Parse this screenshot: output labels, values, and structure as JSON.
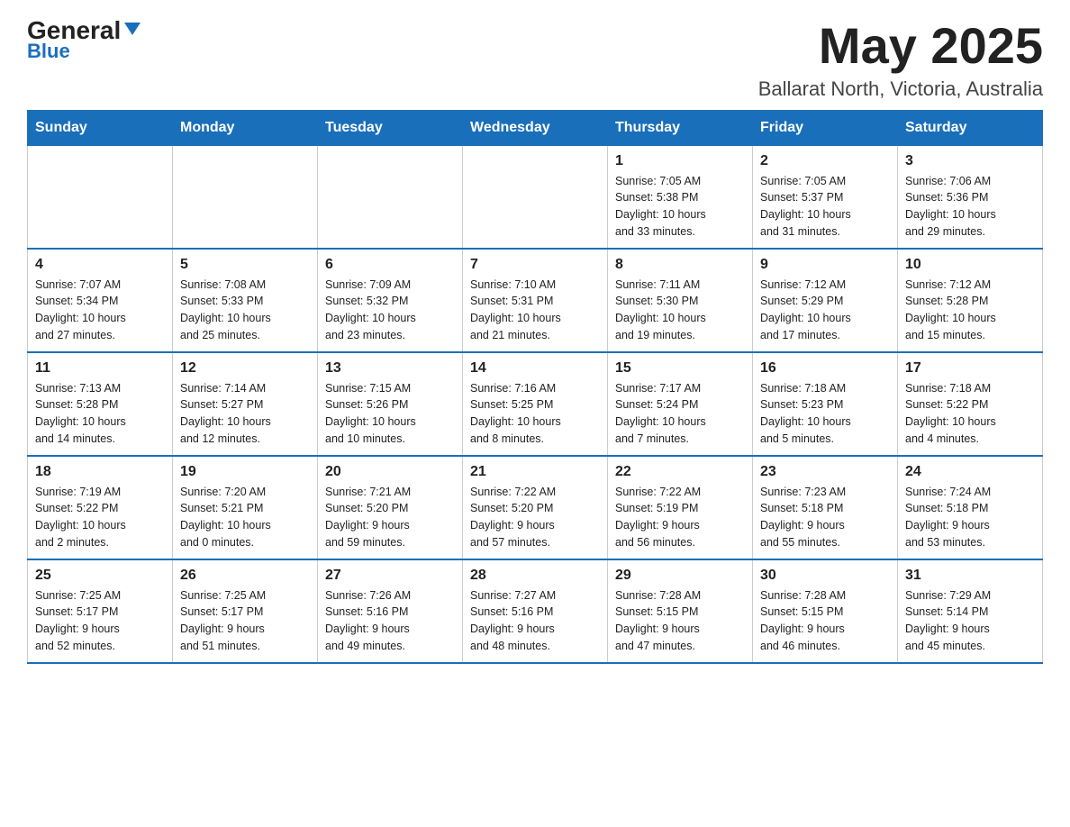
{
  "logo": {
    "general": "General",
    "blue": "Blue"
  },
  "header": {
    "month": "May 2025",
    "location": "Ballarat North, Victoria, Australia"
  },
  "weekdays": [
    "Sunday",
    "Monday",
    "Tuesday",
    "Wednesday",
    "Thursday",
    "Friday",
    "Saturday"
  ],
  "weeks": [
    [
      {
        "day": "",
        "info": ""
      },
      {
        "day": "",
        "info": ""
      },
      {
        "day": "",
        "info": ""
      },
      {
        "day": "",
        "info": ""
      },
      {
        "day": "1",
        "info": "Sunrise: 7:05 AM\nSunset: 5:38 PM\nDaylight: 10 hours\nand 33 minutes."
      },
      {
        "day": "2",
        "info": "Sunrise: 7:05 AM\nSunset: 5:37 PM\nDaylight: 10 hours\nand 31 minutes."
      },
      {
        "day": "3",
        "info": "Sunrise: 7:06 AM\nSunset: 5:36 PM\nDaylight: 10 hours\nand 29 minutes."
      }
    ],
    [
      {
        "day": "4",
        "info": "Sunrise: 7:07 AM\nSunset: 5:34 PM\nDaylight: 10 hours\nand 27 minutes."
      },
      {
        "day": "5",
        "info": "Sunrise: 7:08 AM\nSunset: 5:33 PM\nDaylight: 10 hours\nand 25 minutes."
      },
      {
        "day": "6",
        "info": "Sunrise: 7:09 AM\nSunset: 5:32 PM\nDaylight: 10 hours\nand 23 minutes."
      },
      {
        "day": "7",
        "info": "Sunrise: 7:10 AM\nSunset: 5:31 PM\nDaylight: 10 hours\nand 21 minutes."
      },
      {
        "day": "8",
        "info": "Sunrise: 7:11 AM\nSunset: 5:30 PM\nDaylight: 10 hours\nand 19 minutes."
      },
      {
        "day": "9",
        "info": "Sunrise: 7:12 AM\nSunset: 5:29 PM\nDaylight: 10 hours\nand 17 minutes."
      },
      {
        "day": "10",
        "info": "Sunrise: 7:12 AM\nSunset: 5:28 PM\nDaylight: 10 hours\nand 15 minutes."
      }
    ],
    [
      {
        "day": "11",
        "info": "Sunrise: 7:13 AM\nSunset: 5:28 PM\nDaylight: 10 hours\nand 14 minutes."
      },
      {
        "day": "12",
        "info": "Sunrise: 7:14 AM\nSunset: 5:27 PM\nDaylight: 10 hours\nand 12 minutes."
      },
      {
        "day": "13",
        "info": "Sunrise: 7:15 AM\nSunset: 5:26 PM\nDaylight: 10 hours\nand 10 minutes."
      },
      {
        "day": "14",
        "info": "Sunrise: 7:16 AM\nSunset: 5:25 PM\nDaylight: 10 hours\nand 8 minutes."
      },
      {
        "day": "15",
        "info": "Sunrise: 7:17 AM\nSunset: 5:24 PM\nDaylight: 10 hours\nand 7 minutes."
      },
      {
        "day": "16",
        "info": "Sunrise: 7:18 AM\nSunset: 5:23 PM\nDaylight: 10 hours\nand 5 minutes."
      },
      {
        "day": "17",
        "info": "Sunrise: 7:18 AM\nSunset: 5:22 PM\nDaylight: 10 hours\nand 4 minutes."
      }
    ],
    [
      {
        "day": "18",
        "info": "Sunrise: 7:19 AM\nSunset: 5:22 PM\nDaylight: 10 hours\nand 2 minutes."
      },
      {
        "day": "19",
        "info": "Sunrise: 7:20 AM\nSunset: 5:21 PM\nDaylight: 10 hours\nand 0 minutes."
      },
      {
        "day": "20",
        "info": "Sunrise: 7:21 AM\nSunset: 5:20 PM\nDaylight: 9 hours\nand 59 minutes."
      },
      {
        "day": "21",
        "info": "Sunrise: 7:22 AM\nSunset: 5:20 PM\nDaylight: 9 hours\nand 57 minutes."
      },
      {
        "day": "22",
        "info": "Sunrise: 7:22 AM\nSunset: 5:19 PM\nDaylight: 9 hours\nand 56 minutes."
      },
      {
        "day": "23",
        "info": "Sunrise: 7:23 AM\nSunset: 5:18 PM\nDaylight: 9 hours\nand 55 minutes."
      },
      {
        "day": "24",
        "info": "Sunrise: 7:24 AM\nSunset: 5:18 PM\nDaylight: 9 hours\nand 53 minutes."
      }
    ],
    [
      {
        "day": "25",
        "info": "Sunrise: 7:25 AM\nSunset: 5:17 PM\nDaylight: 9 hours\nand 52 minutes."
      },
      {
        "day": "26",
        "info": "Sunrise: 7:25 AM\nSunset: 5:17 PM\nDaylight: 9 hours\nand 51 minutes."
      },
      {
        "day": "27",
        "info": "Sunrise: 7:26 AM\nSunset: 5:16 PM\nDaylight: 9 hours\nand 49 minutes."
      },
      {
        "day": "28",
        "info": "Sunrise: 7:27 AM\nSunset: 5:16 PM\nDaylight: 9 hours\nand 48 minutes."
      },
      {
        "day": "29",
        "info": "Sunrise: 7:28 AM\nSunset: 5:15 PM\nDaylight: 9 hours\nand 47 minutes."
      },
      {
        "day": "30",
        "info": "Sunrise: 7:28 AM\nSunset: 5:15 PM\nDaylight: 9 hours\nand 46 minutes."
      },
      {
        "day": "31",
        "info": "Sunrise: 7:29 AM\nSunset: 5:14 PM\nDaylight: 9 hours\nand 45 minutes."
      }
    ]
  ]
}
